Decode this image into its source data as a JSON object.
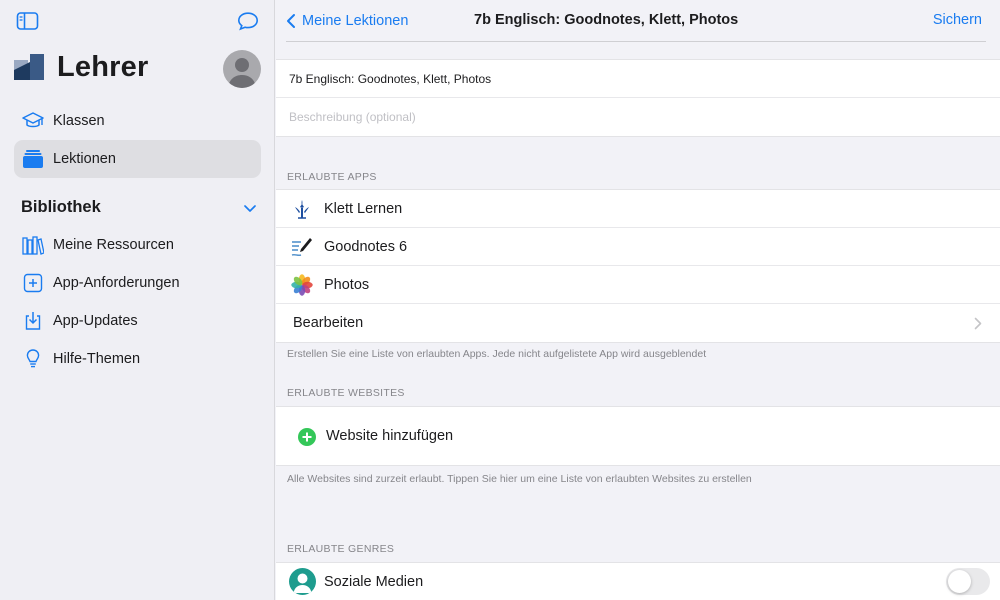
{
  "sidebar": {
    "title": "Lehrer",
    "items": [
      {
        "label": "Klassen",
        "icon": "graduation-cap-icon"
      },
      {
        "label": "Lektionen",
        "icon": "stack-icon",
        "selected": true
      }
    ],
    "library": {
      "title": "Bibliothek",
      "items": [
        {
          "label": "Meine Ressourcen",
          "icon": "books-icon"
        },
        {
          "label": "App-Anforderungen",
          "icon": "plus-square-icon"
        },
        {
          "label": "App-Updates",
          "icon": "download-tray-icon"
        },
        {
          "label": "Hilfe-Themen",
          "icon": "lightbulb-icon"
        }
      ]
    }
  },
  "navbar": {
    "back_label": "Meine Lektionen",
    "title": "7b Englisch: Goodnotes, Klett, Photos",
    "save_label": "Sichern"
  },
  "form": {
    "name_value": "7b Englisch: Goodnotes, Klett, Photos",
    "description_placeholder": "Beschreibung (optional)"
  },
  "allowed_apps": {
    "header": "ERLAUBTE APPS",
    "apps": [
      {
        "label": "Klett Lernen",
        "icon": "klett-app-icon"
      },
      {
        "label": "Goodnotes 6",
        "icon": "goodnotes-app-icon"
      },
      {
        "label": "Photos",
        "icon": "photos-app-icon"
      }
    ],
    "edit_label": "Bearbeiten",
    "footnote": "Erstellen Sie eine Liste von erlaubten Apps. Jede nicht aufgelistete App wird ausgeblendet"
  },
  "allowed_websites": {
    "header": "ERLAUBTE WEBSITES",
    "add_label": "Website hinzufügen",
    "footnote": "Alle Websites sind zurzeit erlaubt. Tippen Sie hier um eine Liste von erlaubten Websites zu erstellen"
  },
  "allowed_genres": {
    "header": "ERLAUBTE GENRES",
    "items": [
      {
        "label": "Soziale Medien",
        "enabled": false
      }
    ]
  },
  "colors": {
    "accent": "#1a7cf0",
    "add_green": "#34c759",
    "sidebar_bg": "#efeff4",
    "selected_bg": "#dedee2"
  }
}
